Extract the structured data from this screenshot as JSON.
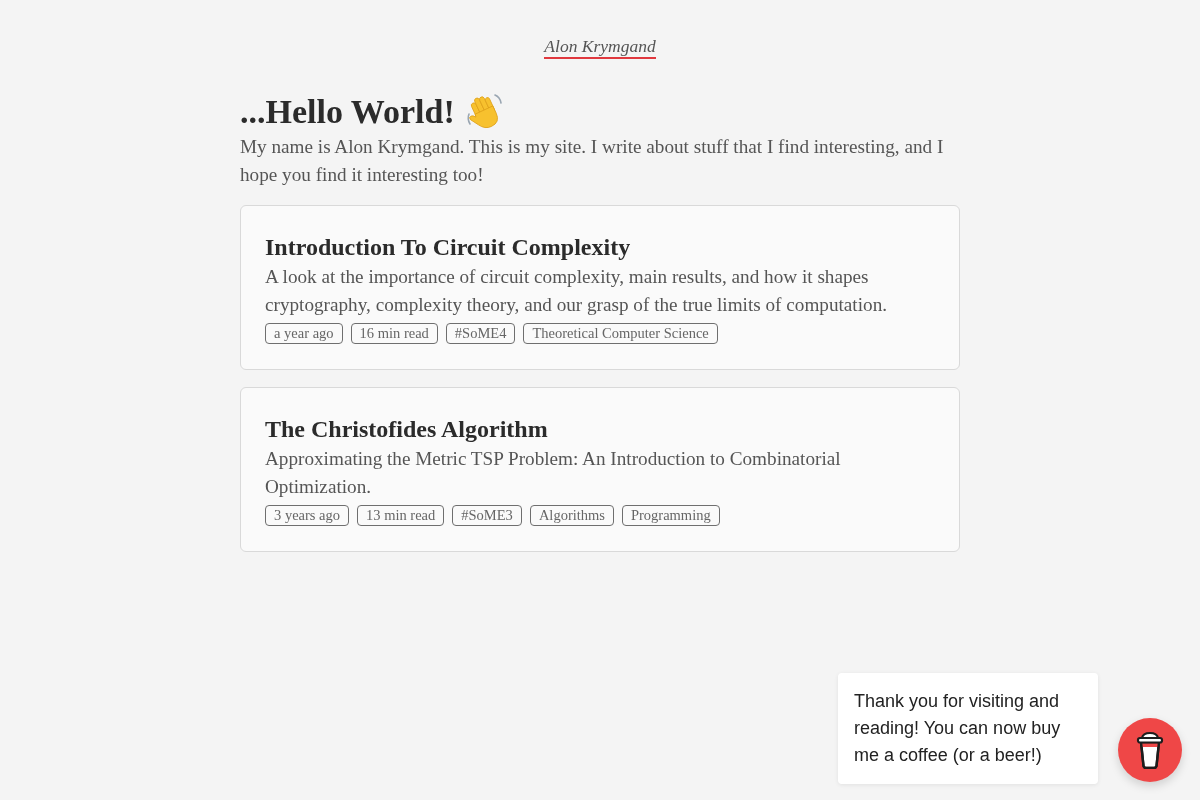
{
  "header": {
    "site_name": "Alon Krymgand"
  },
  "intro": {
    "heading": "...Hello World!",
    "text": "My name is Alon Krymgand. This is my site. I write about stuff that I find interesting, and I hope you find it interesting too!"
  },
  "posts": [
    {
      "title": "Introduction To Circuit Complexity",
      "description": "A look at the importance of circuit complexity, main results, and how it shapes cryptography, complexity theory, and our grasp of the true limits of computation.",
      "tags": [
        "a year ago",
        "16 min read",
        "#SoME4",
        "Theoretical Computer Science"
      ]
    },
    {
      "title": "The Christofides Algorithm",
      "description": "Approximating the Metric TSP Problem: An Introduction to Combinatorial Optimization.",
      "tags": [
        "3 years ago",
        "13 min read",
        "#SoME3",
        "Algorithms",
        "Programming"
      ]
    }
  ],
  "support_widget": {
    "message": "Thank you for visiting and reading! You can now buy me a coffee (or a beer!)"
  }
}
